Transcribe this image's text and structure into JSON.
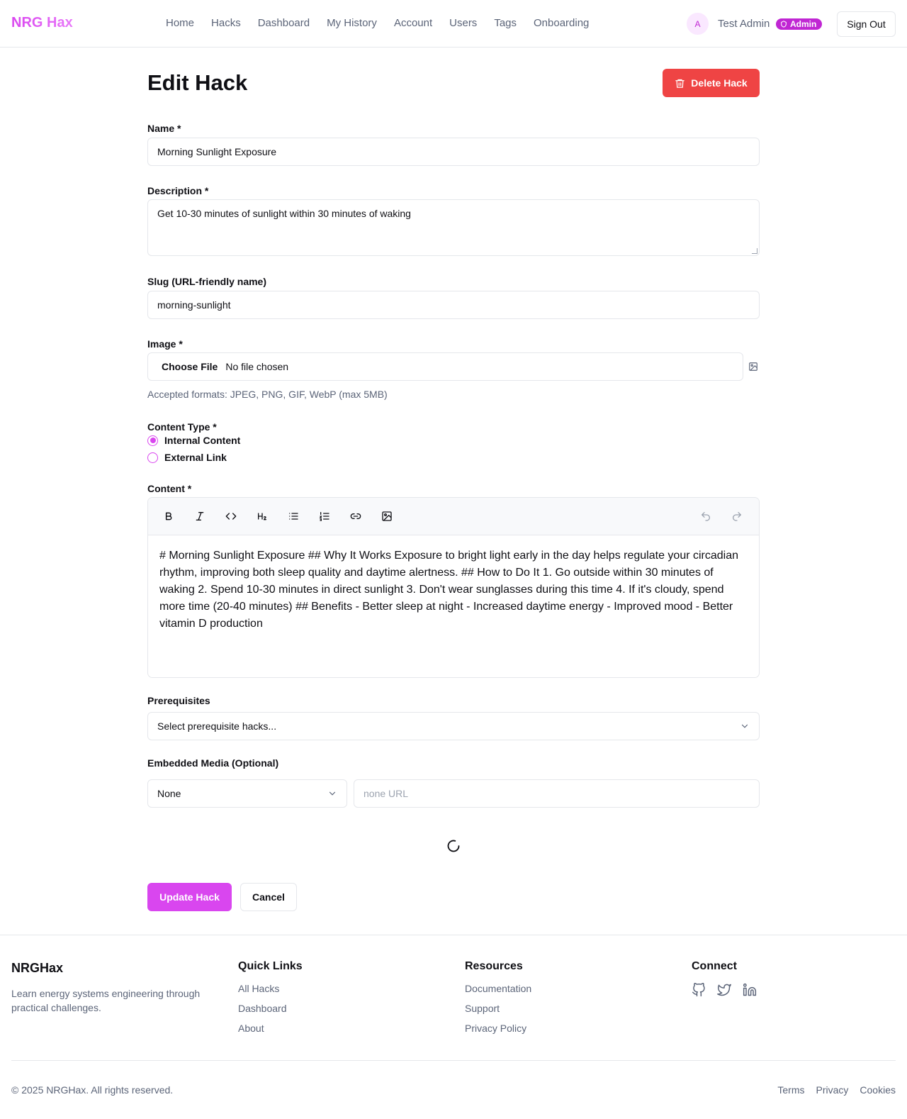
{
  "header": {
    "logo": "NRG Hax",
    "nav": [
      "Home",
      "Hacks",
      "Dashboard",
      "My History",
      "Account",
      "Users",
      "Tags",
      "Onboarding"
    ],
    "avatar_initial": "A",
    "username": "Test Admin",
    "badge": "Admin",
    "sign_out": "Sign Out"
  },
  "page": {
    "title": "Edit Hack",
    "delete_label": "Delete Hack"
  },
  "form": {
    "name_label": "Name *",
    "name_value": "Morning Sunlight Exposure",
    "description_label": "Description *",
    "description_value": "Get 10-30 minutes of sunlight within 30 minutes of waking",
    "slug_label": "Slug (URL-friendly name)",
    "slug_value": "morning-sunlight",
    "image_label": "Image *",
    "file_button": "Choose File",
    "file_status": "No file chosen",
    "image_hint": "Accepted formats: JPEG, PNG, GIF, WebP (max 5MB)",
    "content_type_label": "Content Type *",
    "content_types": [
      "Internal Content",
      "External Link"
    ],
    "content_type_selected": "Internal Content",
    "content_label": "Content *",
    "content_value": "# Morning Sunlight Exposure ## Why It Works Exposure to bright light early in the day helps regulate your circadian rhythm, improving both sleep quality and daytime alertness. ## How to Do It 1. Go outside within 30 minutes of waking 2. Spend 10-30 minutes in direct sunlight 3. Don't wear sunglasses during this time 4. If it's cloudy, spend more time (20-40 minutes) ## Benefits - Better sleep at night - Increased daytime energy - Improved mood - Better vitamin D production",
    "prerequisites_label": "Prerequisites",
    "prerequisites_placeholder": "Select prerequisite hacks...",
    "media_label": "Embedded Media (Optional)",
    "media_type_value": "None",
    "media_url_placeholder": "none URL",
    "update_label": "Update Hack",
    "cancel_label": "Cancel"
  },
  "toolbar_icons": [
    "bold-icon",
    "italic-icon",
    "code-icon",
    "heading-2-icon",
    "bullet-list-icon",
    "ordered-list-icon",
    "link-icon",
    "image-icon",
    "undo-icon",
    "redo-icon"
  ],
  "footer": {
    "brand": "NRGHax",
    "tagline": "Learn energy systems engineering through practical challenges.",
    "quick_links_title": "Quick Links",
    "quick_links": [
      "All Hacks",
      "Dashboard",
      "About"
    ],
    "resources_title": "Resources",
    "resources": [
      "Documentation",
      "Support",
      "Privacy Policy"
    ],
    "connect_title": "Connect",
    "social_icons": [
      "github-icon",
      "twitter-icon",
      "linkedin-icon"
    ],
    "copyright": "© 2025 NRGHax. All rights reserved.",
    "legal": [
      "Terms",
      "Privacy",
      "Cookies"
    ]
  },
  "colors": {
    "brand": "#d946ef",
    "danger": "#ef4444",
    "muted_text": "#5b6478",
    "border": "#e5e7eb"
  }
}
